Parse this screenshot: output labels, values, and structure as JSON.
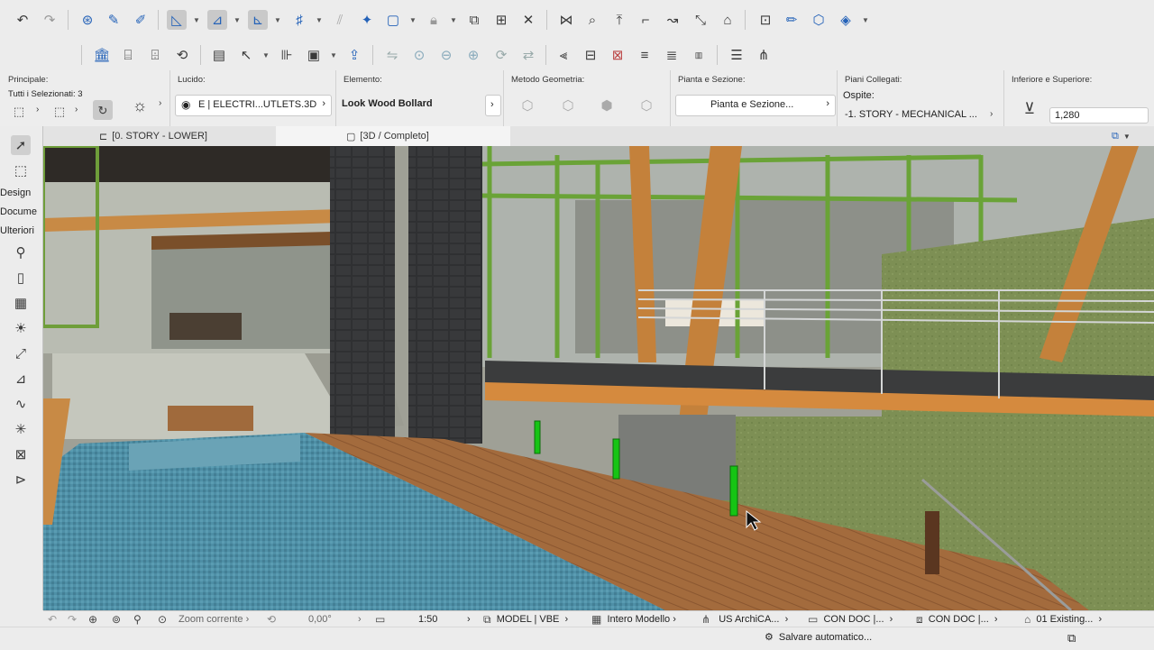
{
  "toolbar_top": {
    "icons": [
      "undo-icon",
      "redo-icon",
      "find-select-icon",
      "eyedropper-icon",
      "injector-icon",
      "arrow-tool-icon",
      "snap-guides-icon",
      "gravity-icon",
      "grid-snap-icon",
      "suspend-groups-icon",
      "magic-wand-icon",
      "selection-box-icon",
      "lock-icon",
      "group-icon",
      "trace-icon",
      "reference-icon",
      "split-icon",
      "adjust-icon",
      "elevate-icon",
      "fillet-icon",
      "offset-icon",
      "stretch-icon",
      "roof-icon",
      "solid-ops-icon",
      "edit-icon",
      "merge-icon",
      "transform-icon"
    ]
  },
  "toolbar_second": {
    "icons": [
      "building-icon",
      "building-plus-icon",
      "building-link-icon",
      "building-update-icon",
      "page-icon",
      "cursor-icon",
      "spreadsheet-icon",
      "save-icon",
      "elevation-icon",
      "mirror-icon",
      "zoom-fit-icon",
      "zoom-out-icon",
      "zoom-in-icon",
      "rotate-icon",
      "flip-icon",
      "align-left-icon",
      "align-center-icon",
      "align-right-icon",
      "distribute-icon",
      "distribute-v-icon",
      "guid-icon",
      "list-icon",
      "tree-icon"
    ]
  },
  "info": {
    "principale_label": "Principale:",
    "principale_value": "Tutti i Selezionati: 3",
    "lucido_label": "Lucido:",
    "lucido_value": "E | ELECTRI...UTLETS.3D",
    "elemento_label": "Elemento:",
    "elemento_value": "Look Wood Bollard",
    "metodo_label": "Metodo Geometria:",
    "pianta_label": "Pianta e Sezione:",
    "pianta_value": "Pianta e Sezione...",
    "piani_label": "Piani Collegati:",
    "ospite_label": "Ospite:",
    "ospite_value": "-1. STORY - MECHANICAL ...",
    "inferiore_label": "Inferiore e Superiore:",
    "inferiore_value": "1,280"
  },
  "tabs": {
    "story": "[0. STORY - LOWER]",
    "view3d": "[3D / Completo]"
  },
  "toolbox": {
    "design": "Design",
    "documenta": "Docume",
    "ulteriori": "Ulteriori"
  },
  "status": {
    "zoom_label": "Zoom corrente",
    "angle": "0,00°",
    "scale": "1:50",
    "model": "MODEL | VBE",
    "model_scope": "Intero Modello",
    "standard": "US ArchiCA...",
    "doc1": "CON DOC |...",
    "doc2": "CON DOC |...",
    "existing": "01 Existing...",
    "autosave": "Salvare automatico..."
  },
  "colors": {
    "accent": "#2462b8",
    "selection_green": "#16c414",
    "wood": "#a06a3c",
    "pool": "#4e8fa6"
  }
}
